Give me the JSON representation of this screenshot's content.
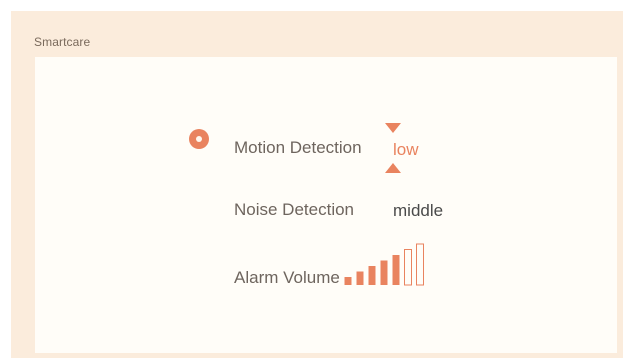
{
  "panel": {
    "title": "Smartcare"
  },
  "settings": {
    "motion_detection": {
      "label": "Motion Detection",
      "value": "low",
      "selected": true
    },
    "noise_detection": {
      "label": "Noise Detection",
      "value": "middle"
    },
    "alarm_volume": {
      "label": "Alarm Volume",
      "level": 5,
      "max_level": 7
    }
  },
  "colors": {
    "accent": "#e9835f",
    "panel_background": "#fbecdc",
    "content_background": "#fffdf8",
    "label_text": "#6e655e",
    "value_text": "#4a4a4a"
  },
  "icons": {
    "selected_indicator": "radio-dot-icon",
    "decrease": "triangle-down-icon",
    "increase": "triangle-up-icon"
  }
}
